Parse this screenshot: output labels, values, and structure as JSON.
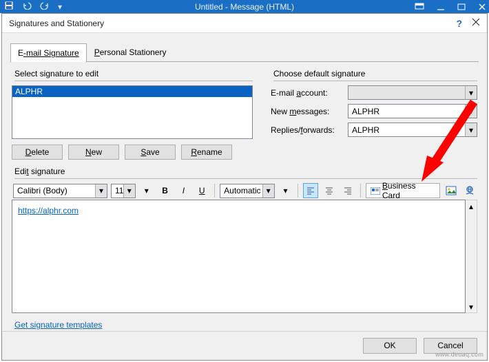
{
  "ribbon": {
    "title": "Untitled - Message (HTML)"
  },
  "dialog": {
    "title": "Signatures and Stationery",
    "help": "?",
    "tabs": {
      "email_pre": "E",
      "email_mid": "-mail Signature",
      "personal_pre": "P",
      "personal_mid": "ersonal Stationery"
    },
    "select_label": "Select signature to edit",
    "signature_items": [
      "ALPHR"
    ],
    "buttons": {
      "delete": "Delete",
      "new": "New",
      "save": "Save",
      "rename": "Rename"
    },
    "defaults": {
      "label": "Choose default signature",
      "account_label": "E-mail account:",
      "account_value": "",
      "new_label": "New messages:",
      "new_value": "ALPHR",
      "replies_label": "Replies/forwards:",
      "replies_value": "ALPHR"
    },
    "edit_label": "Edit signature",
    "toolbar": {
      "font": "Calibri (Body)",
      "size": "11",
      "bold": "B",
      "italic": "I",
      "underline": "U",
      "auto": "Automatic",
      "biz_pre": "B",
      "biz_rest": "usiness Card"
    },
    "editor": {
      "text": "https://alphr.com"
    },
    "templates": "Get signature templates",
    "footer": {
      "ok": "OK",
      "cancel": "Cancel"
    }
  },
  "watermark": "www.deuaq.com"
}
